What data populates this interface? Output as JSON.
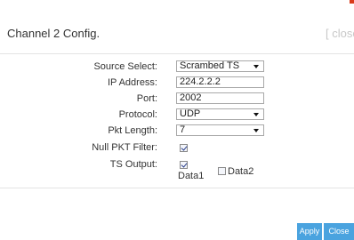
{
  "dialog": {
    "title": "Channel 2 Config.",
    "close_link": "[ close"
  },
  "form": {
    "source_select": {
      "label": "Source Select:",
      "value": "Scrambed TS"
    },
    "ip_address": {
      "label": "IP Address:",
      "value": "224.2.2.2"
    },
    "port": {
      "label": "Port:",
      "value": "2002"
    },
    "protocol": {
      "label": "Protocol:",
      "value": "UDP"
    },
    "pkt_length": {
      "label": "Pkt Length:",
      "value": "7"
    },
    "null_pkt_filter": {
      "label": "Null PKT Filter:",
      "checked": true
    },
    "ts_output": {
      "label": "TS Output:",
      "data1": {
        "label": "Data1",
        "checked": true
      },
      "data2": {
        "label": "Data2",
        "checked": false
      }
    }
  },
  "footer": {
    "apply_label": "Apply",
    "close_label": "Close"
  },
  "colors": {
    "button": "#4aa3df",
    "corner_mark": "#d93a1a"
  }
}
